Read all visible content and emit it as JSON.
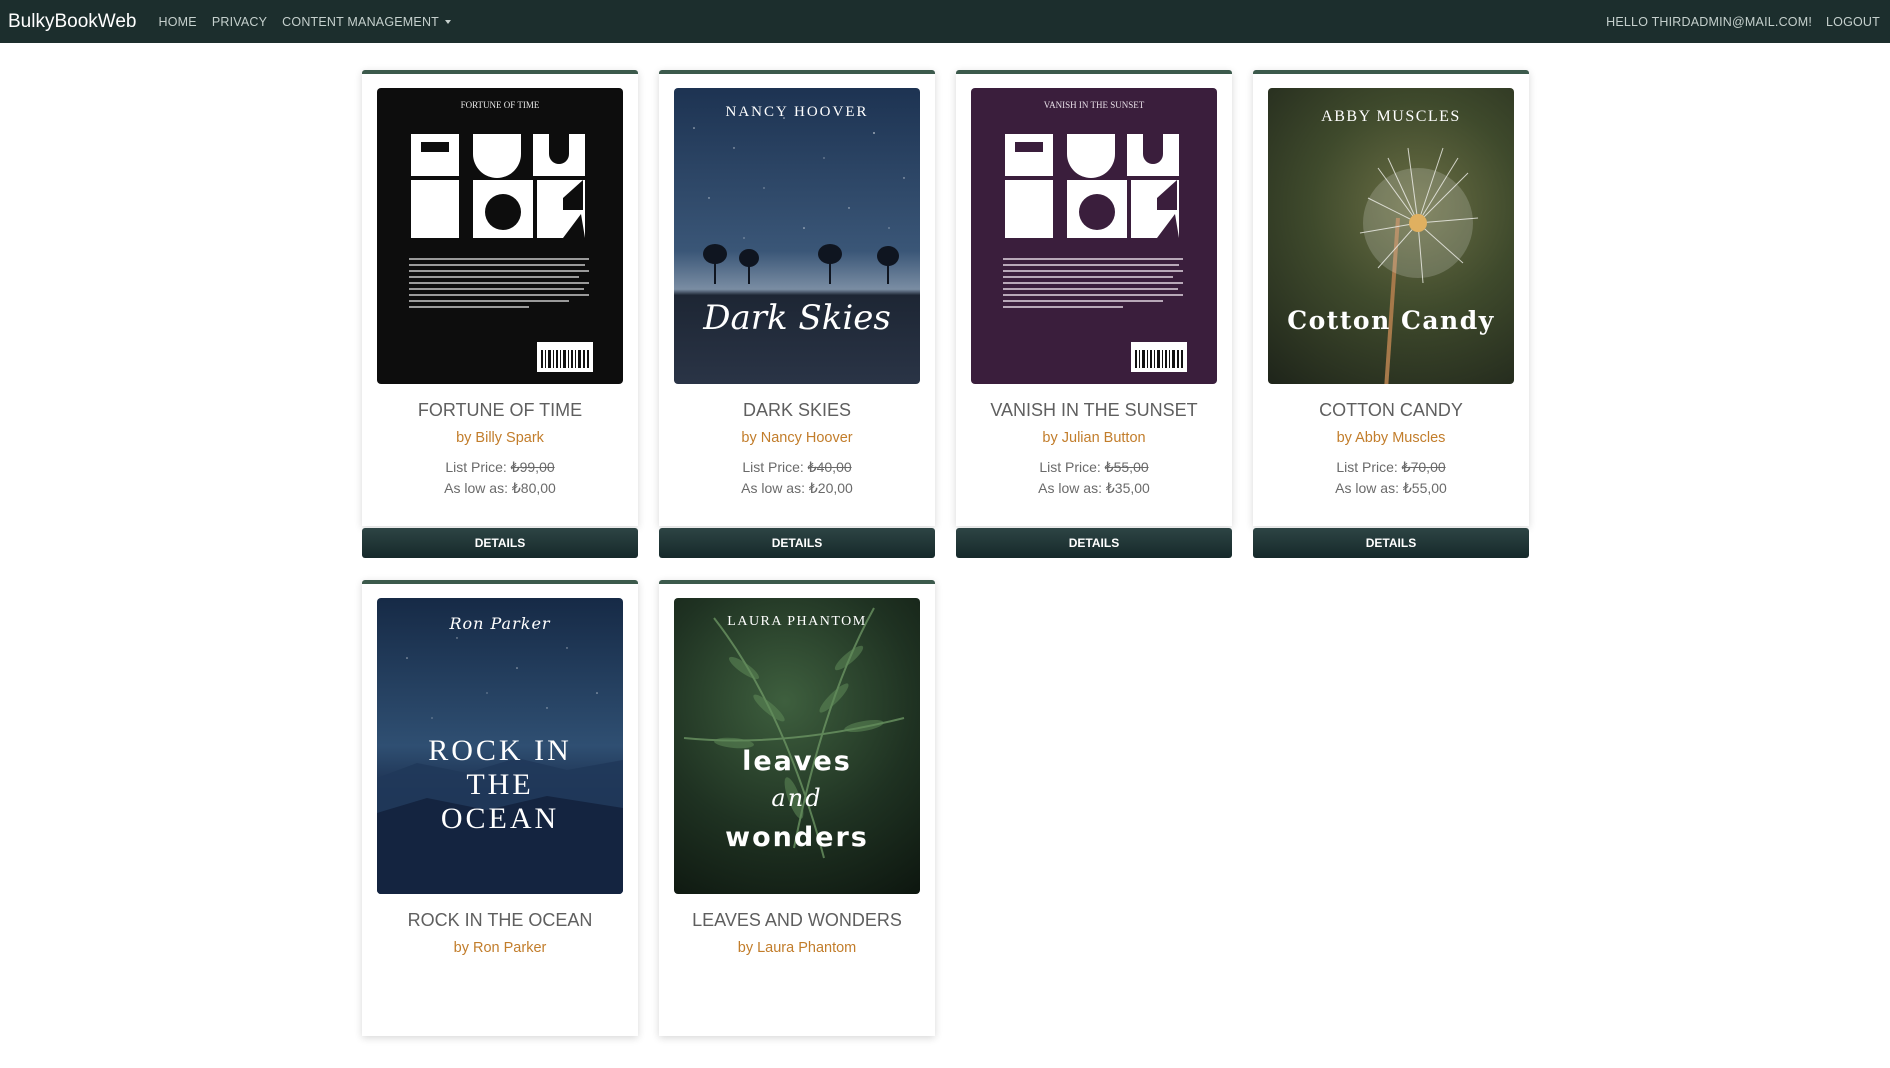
{
  "navbar": {
    "brand": "BulkyBookWeb",
    "links": [
      "HOME",
      "PRIVACY",
      "CONTENT MANAGEMENT"
    ],
    "greeting": "HELLO THIRDADMIN@MAIL.COM!",
    "logout": "LOGOUT"
  },
  "products": [
    {
      "title": "FORTUNE OF TIME",
      "author": "by Billy Spark",
      "list_label": "List Price: ",
      "list_price": "₺99,00",
      "low_label": "As low as: ",
      "low_price": "₺80,00",
      "button": "DETAILS",
      "cover": {
        "top_text": "FORTUNE OF TIME",
        "big_text": "BOOK",
        "bg": "#0d0d0d"
      }
    },
    {
      "title": "DARK SKIES",
      "author": "by Nancy Hoover",
      "list_label": "List Price: ",
      "list_price": "₺40,00",
      "low_label": "As low as: ",
      "low_price": "₺20,00",
      "button": "DETAILS",
      "cover": {
        "top_text": "NANCY HOOVER",
        "big_text": "Dark Skies",
        "bg": "#1e2f48"
      }
    },
    {
      "title": "VANISH IN THE SUNSET",
      "author": "by Julian Button",
      "list_label": "List Price: ",
      "list_price": "₺55,00",
      "low_label": "As low as: ",
      "low_price": "₺35,00",
      "button": "DETAILS",
      "cover": {
        "top_text": "VANISH IN THE SUNSET",
        "big_text": "BOOK",
        "bg": "#3a1e3c"
      }
    },
    {
      "title": "COTTON CANDY",
      "author": "by Abby Muscles",
      "list_label": "List Price: ",
      "list_price": "₺70,00",
      "low_label": "As low as: ",
      "low_price": "₺55,00",
      "button": "DETAILS",
      "cover": {
        "top_text": "ABBY MUSCLES",
        "big_text": "Cotton Candy",
        "bg": "#3f4a2c"
      }
    },
    {
      "title": "ROCK IN THE OCEAN",
      "author": "by Ron Parker",
      "cover": {
        "top_text": "Ron Parker",
        "big_lines": [
          "ROCK IN",
          "THE",
          "OCEAN"
        ],
        "bg": "#1a2f4a"
      }
    },
    {
      "title": "LEAVES AND WONDERS",
      "author": "by Laura Phantom",
      "cover": {
        "top_text": "LAURA PHANTOM",
        "big_lines": [
          "leaves",
          "and",
          "wonders"
        ],
        "bg": "#16251a"
      }
    }
  ],
  "colors": {
    "navbar_bg": "#1c2e2d",
    "card_accent": "#3c5a4c",
    "author": "#c27d2b",
    "button_bg": "#1f3a3a"
  }
}
